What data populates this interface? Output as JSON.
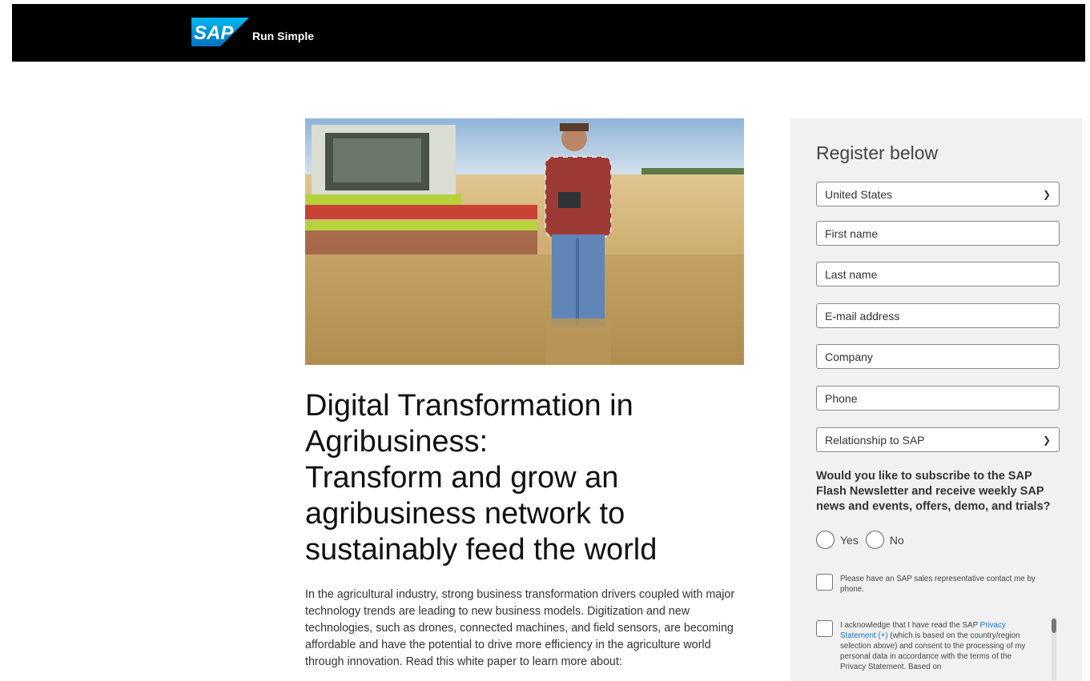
{
  "header": {
    "logo_text": "SAP",
    "tagline": "Run Simple",
    "brand_color": "#008fd3"
  },
  "article": {
    "headline_lines": [
      "Digital Transformation in",
      "Agribusiness:",
      "Transform and grow an",
      "agribusiness network to",
      "sustainably feed the world"
    ],
    "body": "In the agricultural industry, strong business transformation drivers coupled with major technology trends are leading to new business models. Digitization and new technologies, such as drones, connected machines, and field sensors, are becoming affordable and have the potential to drive more efficiency in the agriculture world through innovation. Read this white paper to learn more about:"
  },
  "form": {
    "title": "Register below",
    "country_value": "United States",
    "first_name_placeholder": "First name",
    "last_name_placeholder": "Last name",
    "email_placeholder": "E-mail address",
    "company_placeholder": "Company",
    "phone_placeholder": "Phone",
    "relationship_value": "Relationship to SAP",
    "newsletter_question": "Would you like to subscribe to the SAP Flash Newsletter and receive weekly SAP news and events, offers, demo, and trials?",
    "yes_label": "Yes",
    "no_label": "No",
    "contact_consent": "Please have an SAP sales representative contact me by phone.",
    "privacy_prefix": "I acknowledge that I have read the SAP ",
    "privacy_link": "Privacy Statement (+)",
    "privacy_suffix": " (which is based on the country/region selection above) and consent to the processing of my personal data in accordance with the terms of the Privacy Statement. Based on",
    "link_color": "#1a73c8"
  }
}
